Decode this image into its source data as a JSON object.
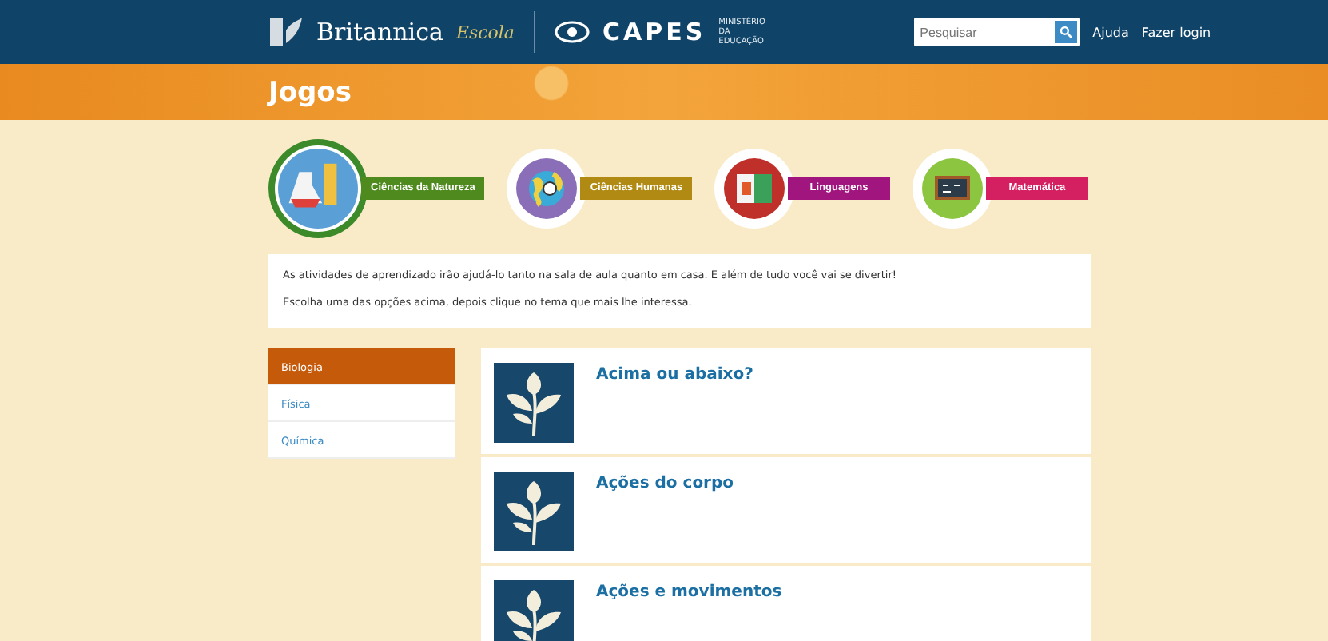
{
  "header": {
    "brand": "Britannica",
    "brand_sub": "Escola",
    "partner": "CAPES",
    "ministry": "MINISTÉRIO DA EDUCAÇÃO",
    "search": {
      "placeholder": "Pesquisar"
    },
    "links": [
      "Ajuda",
      "Fazer login"
    ]
  },
  "banner": {
    "title": "Jogos"
  },
  "categories": [
    {
      "label": "Ciências da Natureza",
      "kind": "flask",
      "color": "#4f8a1e",
      "selected": true
    },
    {
      "label": "Ciências Humanas",
      "kind": "globe",
      "color": "#b08a12",
      "selected": false
    },
    {
      "label": "Linguagens",
      "kind": "book",
      "color": "#a0157e",
      "selected": false
    },
    {
      "label": "Matemática",
      "kind": "board",
      "color": "#d42060",
      "selected": false
    }
  ],
  "intro": [
    "As atividades de aprendizado irão ajudá-lo tanto na sala de aula quanto em casa. E além de tudo você vai se divertir!",
    "Escolha uma das opções acima, depois clique no tema que mais lhe interessa."
  ],
  "sidebar": {
    "items": [
      {
        "label": "Biologia",
        "selected": true
      },
      {
        "label": "Física",
        "selected": false
      },
      {
        "label": "Química",
        "selected": false
      }
    ]
  },
  "games": [
    {
      "title": "Acima ou abaixo?"
    },
    {
      "title": "Ações do corpo"
    },
    {
      "title": "Ações e movimentos"
    }
  ]
}
